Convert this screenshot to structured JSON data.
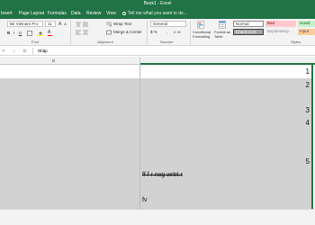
{
  "window": {
    "title": "Book1 - Excel"
  },
  "tabs": [
    "Insert",
    "Page Layout",
    "Formulas",
    "Data",
    "Review",
    "View"
  ],
  "tell_me": "Tell me what you want to do...",
  "ribbon": {
    "font_name": "Be Vietnam Pro",
    "font_size": "11",
    "wrap_text": "Wrap Text",
    "merge_center": "Merge & Center",
    "number_format": "General",
    "conditional_formatting": "Conditional Formatting",
    "format_as_table": "Format as Table",
    "cell_styles": {
      "normal": "Normal",
      "bad": "Bad",
      "good": "Good",
      "check_cell": "Check Cell",
      "explanatory": "Explanatory...",
      "input": "Input"
    },
    "groups": {
      "font": "Font",
      "alignment": "Alignment",
      "number": "Number",
      "styles": "Styles"
    },
    "colors": {
      "bad_bg": "#ffc7ce",
      "good_bg": "#c6efce",
      "check_bg": "#a5a5a5",
      "input_bg": "#ffcc99"
    }
  },
  "formula_bar": {
    "fx": "fx",
    "content": "Nhập"
  },
  "column_header": {
    "label": "B"
  },
  "cells": {
    "numbers": [
      "1",
      "2",
      "3",
      "4",
      "5"
    ],
    "strike_text": "ff f r rwg wrtrt r",
    "text": "fv"
  }
}
